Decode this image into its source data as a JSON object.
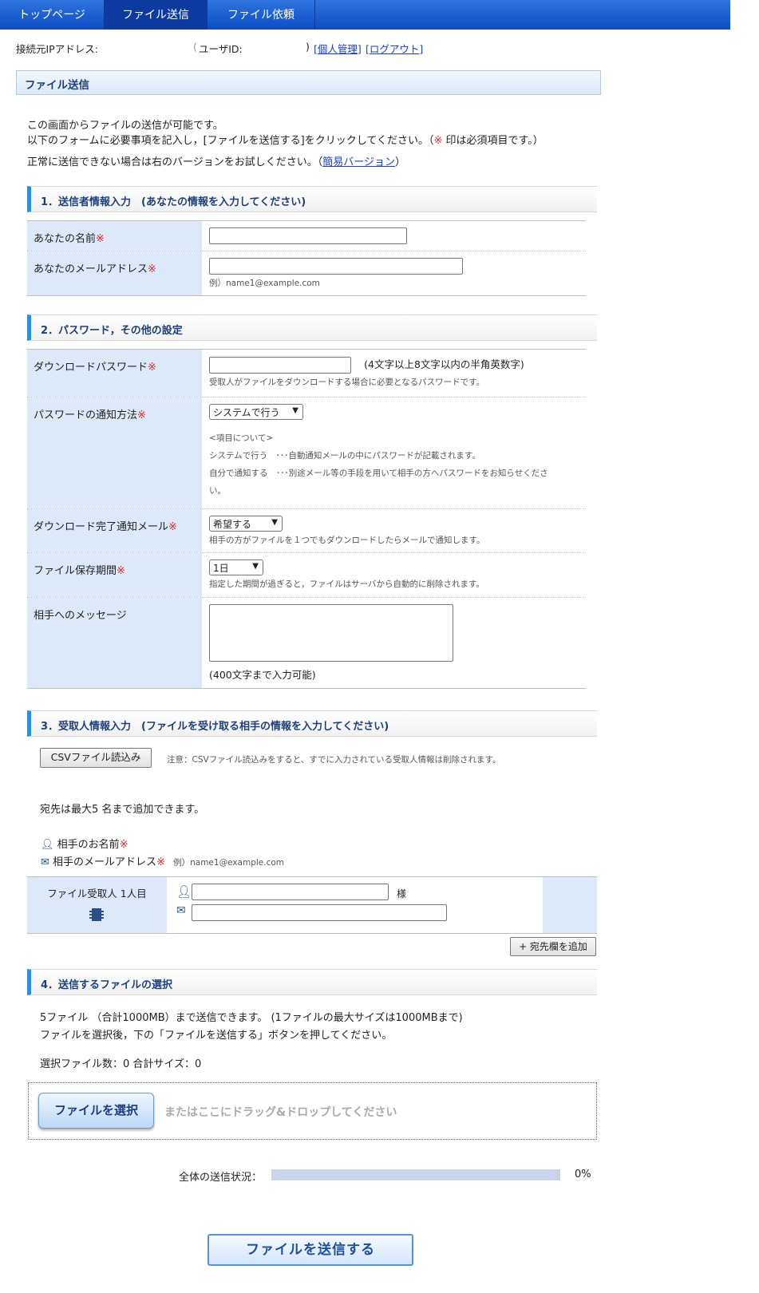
{
  "nav": {
    "items": [
      {
        "label": "トップページ"
      },
      {
        "label": "ファイル送信"
      },
      {
        "label": "ファイル依頼"
      }
    ]
  },
  "userbar": {
    "ip_label": "接続元IPアドレス:",
    "user_label": "ユーザID:",
    "paren_close": ")",
    "personal_link": "[個人管理]",
    "logout_link": "[ログアウト]"
  },
  "page_title": "ファイル送信",
  "intro": {
    "line1": "この画面からファイルの送信が可能です。",
    "line2_prefix": "以下のフォームに必要事項を記入し，[ファイルを送信する]をクリックしてください。（",
    "required_mark": "※",
    "line2_suffix": " 印は必須項目です。）",
    "line3_prefix": "正常に送信できない場合は右のバージョンをお試しください。（",
    "simple_link": "簡易バージョン",
    "line3_suffix": "）"
  },
  "section1": {
    "title": "1．送信者情報入力　(あなたの情報を入力してください)",
    "name_label": "あなたの名前",
    "email_label": "あなたのメールアドレス",
    "email_example": "例）name1@example.com"
  },
  "section2": {
    "title": "2．パスワード，その他の設定",
    "pw_label": "ダウンロードパスワード",
    "pw_hint": "(4文字以上8文字以内の半角英数字)",
    "pw_note": "受取人がファイルをダウンロードする場合に必要となるパスワードです。",
    "notify_label": "パスワードの通知方法",
    "notify_value": "システムで行う",
    "notify_about": "<項目について>",
    "notify_line1": "システムで行う　･･･自動通知メールの中にパスワードが記載されます。",
    "notify_line2": "自分で通知する　･･･別途メール等の手段を用いて相手の方へパスワードをお知らせくださ",
    "notify_line3": "い。",
    "complete_label": "ダウンロード完了通知メール",
    "complete_value": "希望する",
    "complete_note": "相手の方がファイルを１つでもダウンロードしたらメールで通知します。",
    "period_label": "ファイル保存期間",
    "period_value": "1日",
    "period_note": "指定した期間が過ぎると，ファイルはサーバから自動的に削除されます。",
    "message_label": "相手へのメッセージ",
    "message_note": "(400文字まで入力可能)"
  },
  "section3": {
    "title": "3．受取人情報入力　(ファイルを受け取る相手の情報を入力してください)",
    "csv_button": "CSVファイル読込み",
    "csv_note": "注意：CSVファイル読込みをすると、すでに入力されている受取人情報は削除されます。",
    "max_text": "宛先は最大5 名まで追加できます。",
    "legend_name": "相手のお名前",
    "legend_email": "相手のメールアドレス",
    "legend_example": "例）name1@example.com",
    "recipient_label": "ファイル受取人 1人目",
    "honorific": "様",
    "add_button": "+ 宛先欄を追加"
  },
  "section4": {
    "title": "4．送信するファイルの選択",
    "line1": "5ファイル （合計1000MB）まで送信できます。 (1ファイルの最大サイズは1000MBまで)",
    "line2": "ファイルを選択後，下の「ファイルを送信する」ボタンを押してください。",
    "count_text": "選択ファイル数：0  合計サイズ：0",
    "select_button": "ファイルを選択",
    "drop_text": "またはここにドラッグ&ドロップしてください",
    "progress_label": "全体の送信状況：",
    "progress_value": "0%",
    "progress_fraction": 0,
    "send_button": "ファイルを送信する"
  },
  "colors": {
    "nav": "#1a5bd0",
    "required": "#e0292b",
    "label_bg": "#dde9f8",
    "section_accent": "#2f8fd6"
  }
}
